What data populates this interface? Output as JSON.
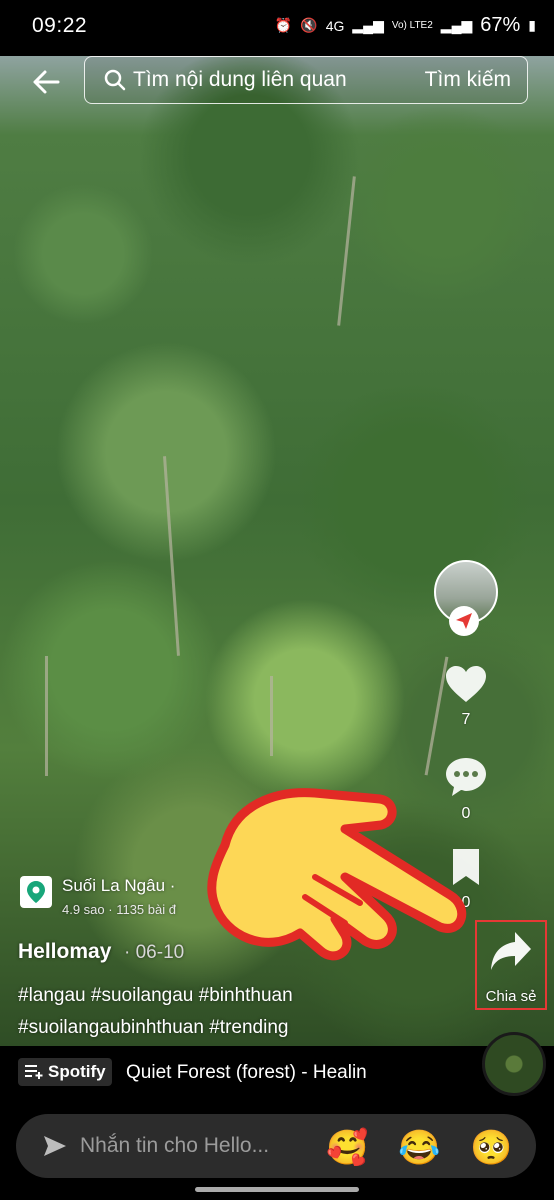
{
  "status_bar": {
    "time": "09:22",
    "network": "4G",
    "volte": "Vo) LTE2",
    "battery": "67%"
  },
  "search": {
    "placeholder": "Tìm nội dung liên quan",
    "button": "Tìm kiếm"
  },
  "rail": {
    "likes": "7",
    "comments": "0",
    "saves": "0",
    "share_label": "Chia sẻ"
  },
  "location": {
    "name": "Suối La Ngâu ·",
    "meta": "4.9 sao · 1135 bài đ"
  },
  "post": {
    "author": "Hellomay",
    "date": "· 06-10",
    "tags_line1": "#langau #suoilangau #binhthuan",
    "tags_line2": "#suoilangaubinhthuan #trending"
  },
  "music": {
    "service": "Spotify",
    "title": "Quiet Forest (forest) - Healin"
  },
  "message": {
    "placeholder": "Nhắn tin cho Hello...",
    "emojis": [
      "🥰",
      "😂",
      "🥺"
    ]
  },
  "colors": {
    "highlight": "#e53935",
    "hand": "#fdd756",
    "hand_outline": "#e22a25",
    "background": "#000000"
  }
}
